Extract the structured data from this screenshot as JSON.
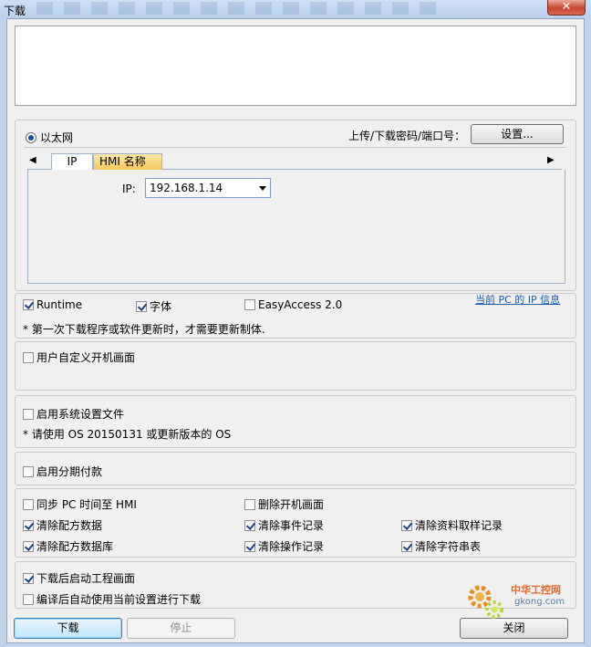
{
  "window": {
    "title": "下载",
    "close_glyph": "✕"
  },
  "ethernet": {
    "label": "以太网",
    "password_label": "上传/下载密码/端口号：",
    "settings_button": "设置..."
  },
  "tabs": [
    {
      "label": "IP"
    },
    {
      "label": "HMI 名称"
    }
  ],
  "ip": {
    "label": "IP:",
    "value": "192.168.1.14"
  },
  "options": {
    "runtime": "Runtime",
    "font": "字体",
    "easyaccess": "EasyAccess 2.0",
    "note": "* 第一次下载程序或软件更新时，才需要更新制体.",
    "pc_ip_link": "当前 PC 的 IP 信息"
  },
  "custom_boot": "用户自定义开机画面",
  "system_file": {
    "label": "启用系统设置文件",
    "note": "* 请使用 OS 20150131 或更新版本的 OS"
  },
  "installment": "启用分期付款",
  "sync": {
    "sync_time": "同步 PC 时间至 HMI",
    "delete_boot": "删除开机画面",
    "clear_recipe": "清除配方数据",
    "clear_event": "清除事件记录",
    "clear_sampling": "清除资料取样记录",
    "clear_recipe_db": "清除配方数据库",
    "clear_op": "清除操作记录",
    "clear_string": "清除字符串表"
  },
  "after": {
    "start_after": "下载后启动工程画面",
    "auto_download": "编译后自动使用当前设置进行下载"
  },
  "buttons": {
    "download": "下载",
    "stop": "停止",
    "close": "关闭"
  },
  "watermark": {
    "text1": "中华工控网",
    "text2": "gkong.com"
  }
}
